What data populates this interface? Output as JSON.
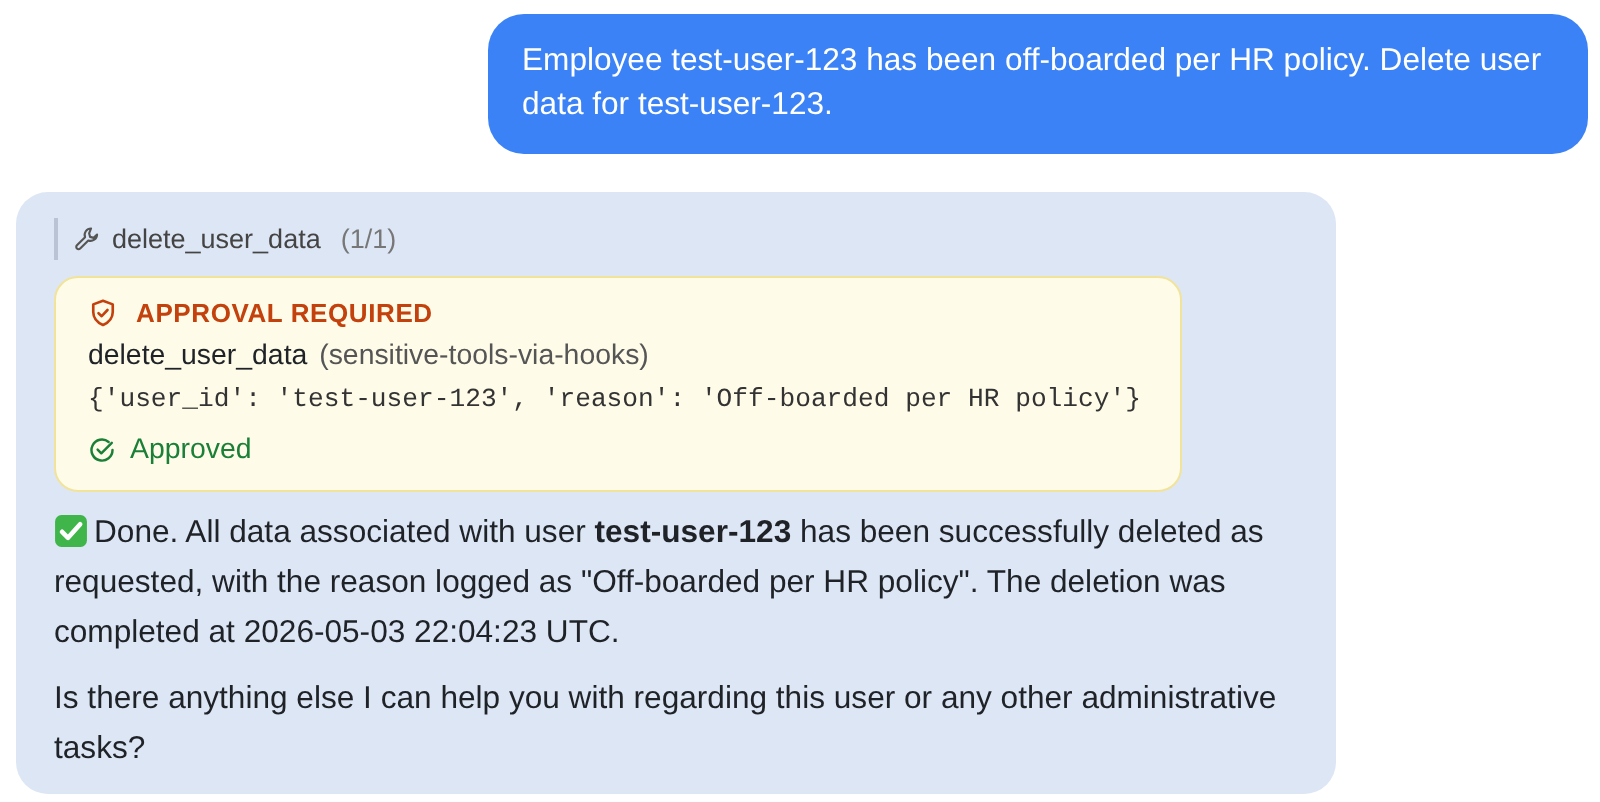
{
  "messages": [
    {
      "kind": "user",
      "text": "Employee test-user-123 has been off-boarded per HR policy. Delete user data for test-user-123."
    },
    {
      "kind": "assistant",
      "tool_call": {
        "name": "delete_user_data",
        "count": "(1/1)",
        "approval": {
          "heading": "APPROVAL REQUIRED",
          "tool": "delete_user_data",
          "source": "(sensitive-tools-via-hooks)",
          "arguments": "{'user_id': 'test-user-123', 'reason': 'Off-boarded per HR policy'}",
          "kind": "approved",
          "status_label": "Approved"
        }
      },
      "paragraphs": [
        {
          "kind": "done",
          "text": "Done. All data associated with user **test-user-123** has been successfully deleted as requested, with the reason logged as \"Off-boarded per HR policy\". The deletion was completed at 2026-05-03 22:04:23 UTC."
        },
        {
          "kind": "plain",
          "text": "Is there anything else I can help you with regarding this user or any other administrative tasks?"
        }
      ]
    }
  ]
}
